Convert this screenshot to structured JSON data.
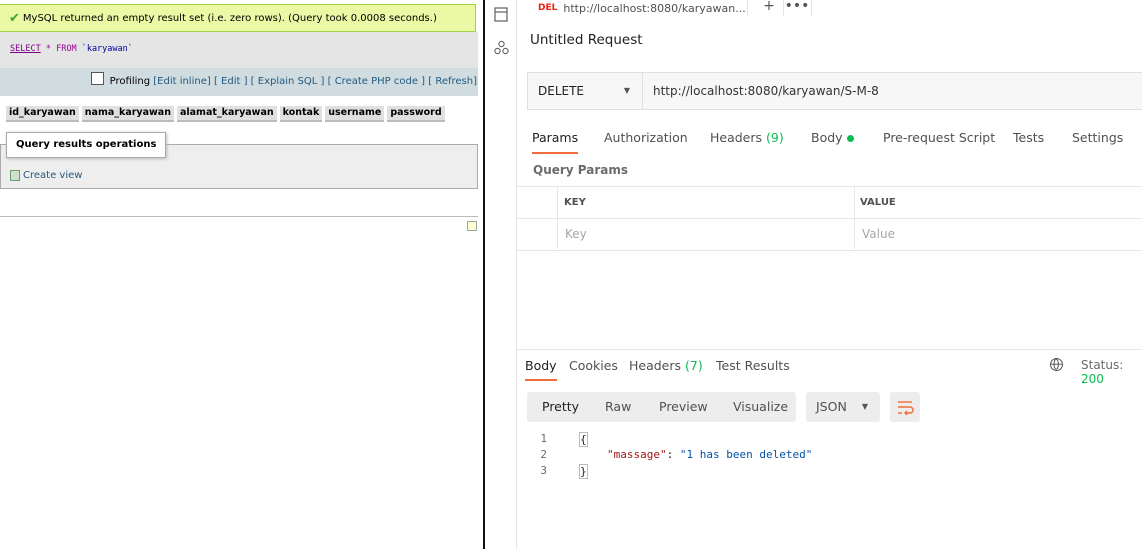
{
  "pma": {
    "success_msg": "MySQL returned an empty result set (i.e. zero rows). (Query took 0.0008 seconds.)",
    "sql": {
      "kw_select": "SELECT",
      "star": "*",
      "kw_from": "FROM",
      "table": "`karyawan`"
    },
    "profiling_label": "Profiling",
    "links": {
      "edit_inline": "[Edit inline]",
      "edit": "[ Edit ]",
      "explain": "[ Explain SQL ]",
      "php": "[ Create PHP code ]",
      "refresh": "[ Refresh]"
    },
    "columns": [
      "id_karyawan",
      "nama_karyawan",
      "alamat_karyawan",
      "kontak",
      "username",
      "password"
    ],
    "ops_title": "Query results operations",
    "create_view": "Create view"
  },
  "postman": {
    "tab": {
      "method": "DEL",
      "url": "http://localhost:8080/karyawan..."
    },
    "request_title": "Untitled Request",
    "method": "DELETE",
    "url": "http://localhost:8080/karyawan/S-M-8",
    "request_tabs": {
      "params": "Params",
      "auth": "Authorization",
      "headers": "Headers",
      "headers_count": "(9)",
      "body": "Body",
      "prereq": "Pre-request Script",
      "tests": "Tests",
      "settings": "Settings"
    },
    "query_params": "Query Params",
    "table": {
      "key_header": "KEY",
      "value_header": "VALUE",
      "key_placeholder": "Key",
      "value_placeholder": "Value"
    },
    "response_tabs": {
      "body": "Body",
      "cookies": "Cookies",
      "headers": "Headers",
      "headers_count": "(7)",
      "tests": "Test Results"
    },
    "status_label": "Status:",
    "status_code": "200",
    "view_modes": {
      "pretty": "Pretty",
      "raw": "Raw",
      "preview": "Preview",
      "visualize": "Visualize"
    },
    "format": "JSON",
    "code": {
      "lines": [
        "1",
        "2",
        "3"
      ],
      "open": "{",
      "key": "\"massage\"",
      "colon": ": ",
      "value": "\"1 has been deleted\"",
      "close": "}"
    },
    "colors": {
      "accent": "#f26b3a",
      "success": "#0cbb52",
      "method_delete": "#eb2013"
    }
  }
}
